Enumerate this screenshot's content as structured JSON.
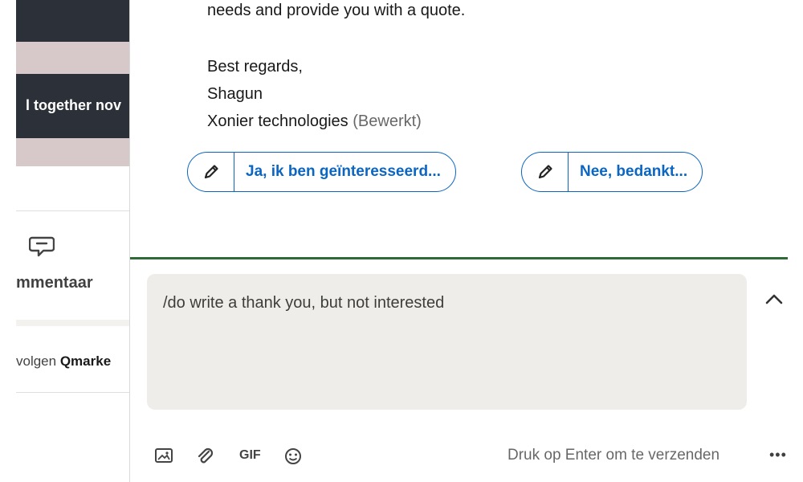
{
  "feed": {
    "banner_text": "l together nov",
    "comment_label": "mmentaar",
    "follow_prefix": "volgen ",
    "follow_name": "Qmarke"
  },
  "message": {
    "line_top": "needs and provide you with a quote.",
    "closing": "Best regards,",
    "name": "Shagun",
    "company": "Xonier technologies",
    "edited_tag": "(Bewerkt)"
  },
  "suggestions": [
    {
      "label": "Ja, ik ben geïnteresseerd..."
    },
    {
      "label": "Nee, bedankt..."
    }
  ],
  "composer": {
    "value": "/do write a thank you, but not interested"
  },
  "toolbar": {
    "gif_label": "GIF",
    "send_hint": "Druk op Enter om te verzenden",
    "more_label": "•••"
  },
  "colors": {
    "accent": "#0a66c2",
    "divider": "#2e6b37",
    "composer_bg": "#eeede9"
  }
}
